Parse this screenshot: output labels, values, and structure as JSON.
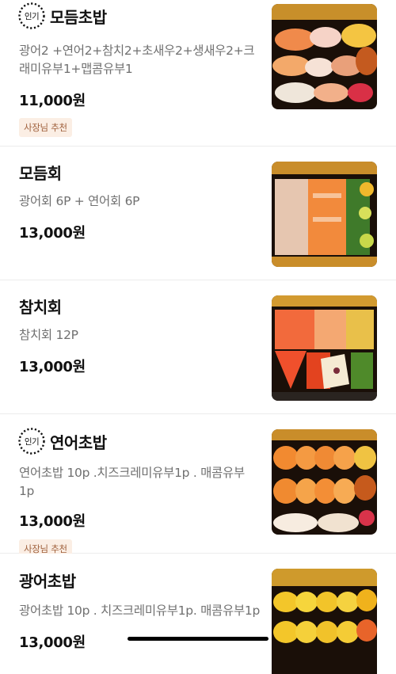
{
  "badge_label": "인기",
  "items": [
    {
      "name": "모듬초밥",
      "description": "광어2 +연어2+참치2+초새우2+생새우2+크래미유부1+맵콤유부1",
      "price": "11,000원",
      "tag": "사장님 추천",
      "popular": true
    },
    {
      "name": "모듬회",
      "description": "광어회 6P  + 연어회 6P",
      "price": "13,000원",
      "tag": null,
      "popular": false
    },
    {
      "name": "참치회",
      "description": "참치회   12P",
      "price": "13,000원",
      "tag": null,
      "popular": false
    },
    {
      "name": "연어초밥",
      "description": "연어초밥 10p .치즈크레미유부1p . 매콤유부 1p",
      "price": "13,000원",
      "tag": "사장님 추천",
      "popular": true
    },
    {
      "name": "광어초밥",
      "description": "광어초밥 10p .  치즈크레미유부1p. 매콤유부1p",
      "price": "13,000원",
      "tag": null,
      "popular": false
    }
  ],
  "colors": {
    "tag_bg": "#fbeee4",
    "tag_text": "#a0613d",
    "desc": "#707070"
  }
}
